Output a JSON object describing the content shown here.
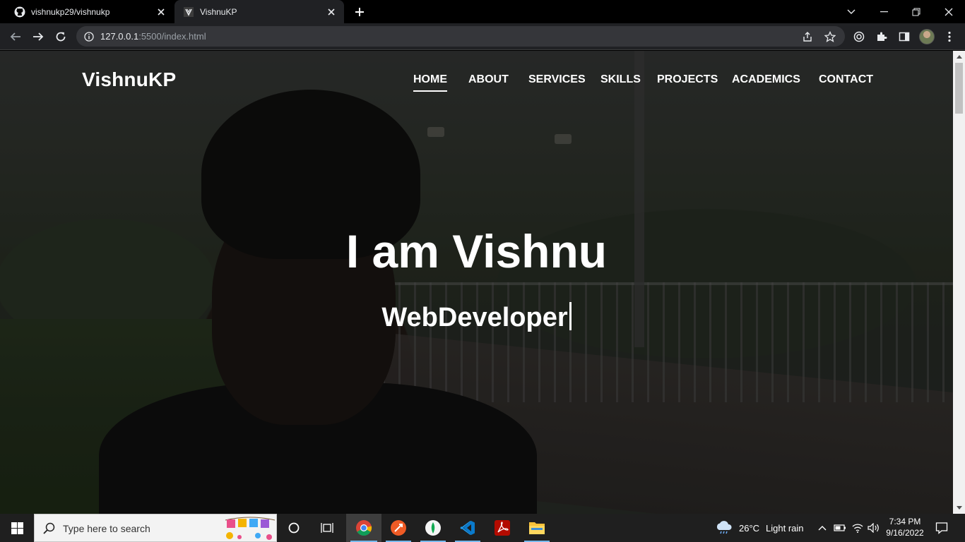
{
  "browser": {
    "tabs": [
      {
        "title": "vishnukp29/vishnukp",
        "icon": "github-icon",
        "active": false
      },
      {
        "title": "VishnuKP",
        "icon": "site-favicon",
        "active": true
      }
    ],
    "url_host": "127.0.0.1",
    "url_rest": ":5500/index.html"
  },
  "site": {
    "brand": "VishnuKP",
    "nav": [
      {
        "label": "HOME",
        "active": true
      },
      {
        "label": "ABOUT",
        "active": false
      },
      {
        "label": "SERVICES",
        "active": false
      },
      {
        "label": "SKILLS",
        "active": false
      },
      {
        "label": "PROJECTS",
        "active": false
      },
      {
        "label": "ACADEMICS",
        "active": false
      },
      {
        "label": "CONTACT",
        "active": false
      }
    ],
    "hero_title": "I am Vishnu",
    "hero_subtitle": "WebDeveloper"
  },
  "taskbar": {
    "search_placeholder": "Type here to search",
    "apps": [
      "chrome-icon",
      "postman-icon",
      "mongodb-compass-icon",
      "vscode-icon",
      "acrobat-icon",
      "file-explorer-icon"
    ],
    "weather_temp": "26°C",
    "weather_desc": "Light rain",
    "time": "7:34 PM",
    "date": "9/16/2022"
  },
  "colors": {
    "chrome_dark": "#202124",
    "omnibox": "#35363a",
    "taskbar": "#1f1f1f",
    "vscode_blue": "#0a7acc",
    "postman_orange": "#ef5b25",
    "acrobat_red": "#b30b00"
  }
}
